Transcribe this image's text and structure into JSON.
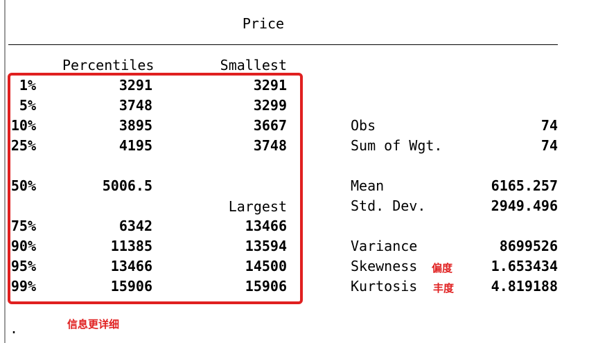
{
  "title": "Price",
  "headers": {
    "percentiles": "Percentiles",
    "smallest": "Smallest",
    "largest": "Largest"
  },
  "rows": [
    {
      "pct": "1%",
      "value": "3291",
      "extreme": "3291"
    },
    {
      "pct": "5%",
      "value": "3748",
      "extreme": "3299"
    },
    {
      "pct": "10%",
      "value": "3895",
      "extreme": "3667"
    },
    {
      "pct": "25%",
      "value": "4195",
      "extreme": "3748"
    },
    {
      "pct": "50%",
      "value": "5006.5",
      "extreme": ""
    },
    {
      "pct": "75%",
      "value": "6342",
      "extreme": "13466"
    },
    {
      "pct": "90%",
      "value": "11385",
      "extreme": "13594"
    },
    {
      "pct": "95%",
      "value": "13466",
      "extreme": "14500"
    },
    {
      "pct": "99%",
      "value": "15906",
      "extreme": "15906"
    }
  ],
  "stats": [
    {
      "label": "Obs",
      "value": "74"
    },
    {
      "label": "Sum of Wgt.",
      "value": "74"
    },
    {
      "label": "Mean",
      "value": "6165.257"
    },
    {
      "label": "Std. Dev.",
      "value": "2949.496"
    },
    {
      "label": "Variance",
      "value": "8699526"
    },
    {
      "label": "Skewness",
      "value": "1.653434"
    },
    {
      "label": "Kurtosis",
      "value": "4.819188"
    }
  ],
  "annotations": {
    "skewness": "偏度",
    "kurtosis": "丰度",
    "detail": "信息更详细"
  },
  "prompt": ".",
  "colors": {
    "annotation_red": "#e02020",
    "text": "#000000",
    "background": "#ffffff"
  }
}
